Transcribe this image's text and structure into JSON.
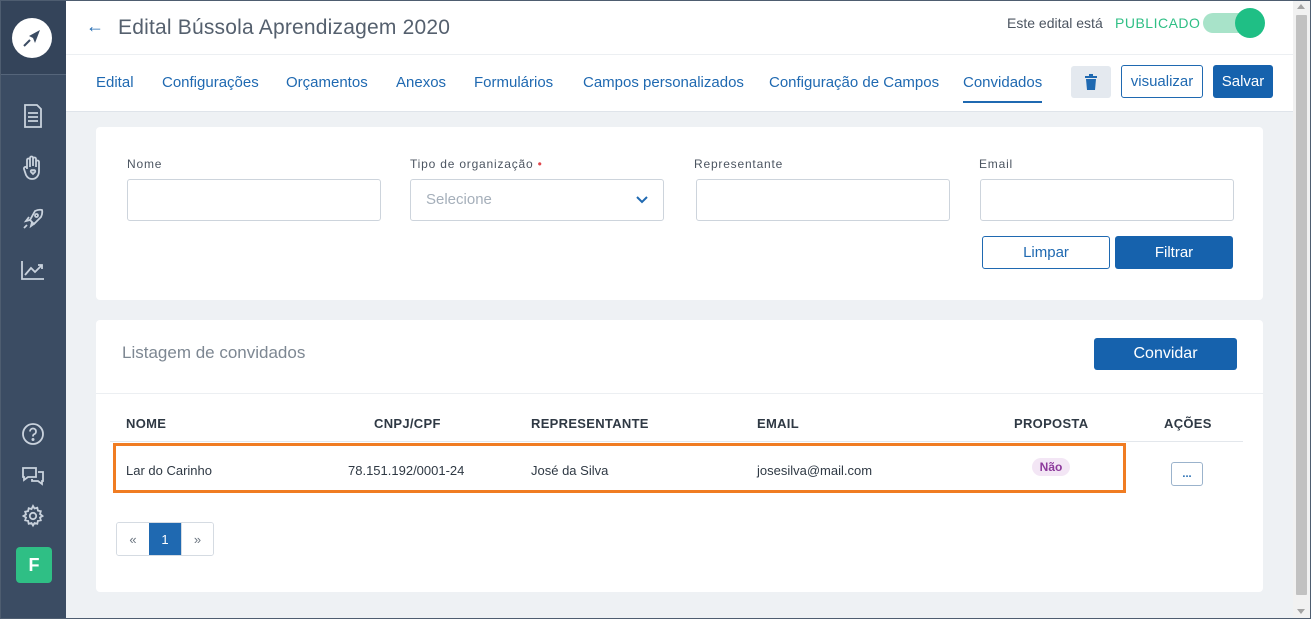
{
  "sidebar": {
    "logo_icon": "compass-icon",
    "nav_icons": [
      "document-icon",
      "hand-heart-icon",
      "rocket-icon",
      "chart-trend-icon"
    ],
    "bottom_icons": [
      "help-icon",
      "chat-icon",
      "gear-icon"
    ],
    "avatar_initial": "F",
    "colors": {
      "background": "#3b4c63",
      "avatar": "#2fbf85"
    }
  },
  "header": {
    "title": "Edital Bússola Aprendizagem 2020",
    "status_prefix": "Este edital está",
    "status_value": "PUBLICADO",
    "toggle_on": true
  },
  "tabs": [
    {
      "label": "Edital"
    },
    {
      "label": "Configurações"
    },
    {
      "label": "Orçamentos"
    },
    {
      "label": "Anexos"
    },
    {
      "label": "Formulários"
    },
    {
      "label": "Campos personalizados"
    },
    {
      "label": "Configuração de Campos"
    },
    {
      "label": "Convidados",
      "active": true
    }
  ],
  "toolbar": {
    "delete_icon": "trash-icon",
    "view_label": "visualizar",
    "save_label": "Salvar"
  },
  "filters": {
    "nome_label": "Nome",
    "nome_value": "",
    "tipo_label": "Tipo de organização",
    "tipo_required": "•",
    "tipo_placeholder": "Selecione",
    "representante_label": "Representante",
    "representante_value": "",
    "email_label": "Email",
    "email_value": "",
    "clear_label": "Limpar",
    "filter_label": "Filtrar"
  },
  "list": {
    "title": "Listagem de convidados",
    "invite_label": "Convidar",
    "columns": {
      "nome": "NOME",
      "cnpj": "CNPJ/CPF",
      "representante": "REPRESENTANTE",
      "email": "EMAIL",
      "proposta": "PROPOSTA",
      "acoes": "AÇÕES"
    },
    "rows": [
      {
        "nome": "Lar do Carinho",
        "cnpj": "78.151.192/0001-24",
        "representante": "José da Silva",
        "email": "josesilva@mail.com",
        "proposta": "Não",
        "acoes": "..."
      }
    ],
    "pagination": {
      "prev": "«",
      "current": "1",
      "next": "»"
    }
  },
  "colors": {
    "primary": "#1662ad",
    "success": "#2fbf85",
    "highlight": "#f07c22"
  }
}
